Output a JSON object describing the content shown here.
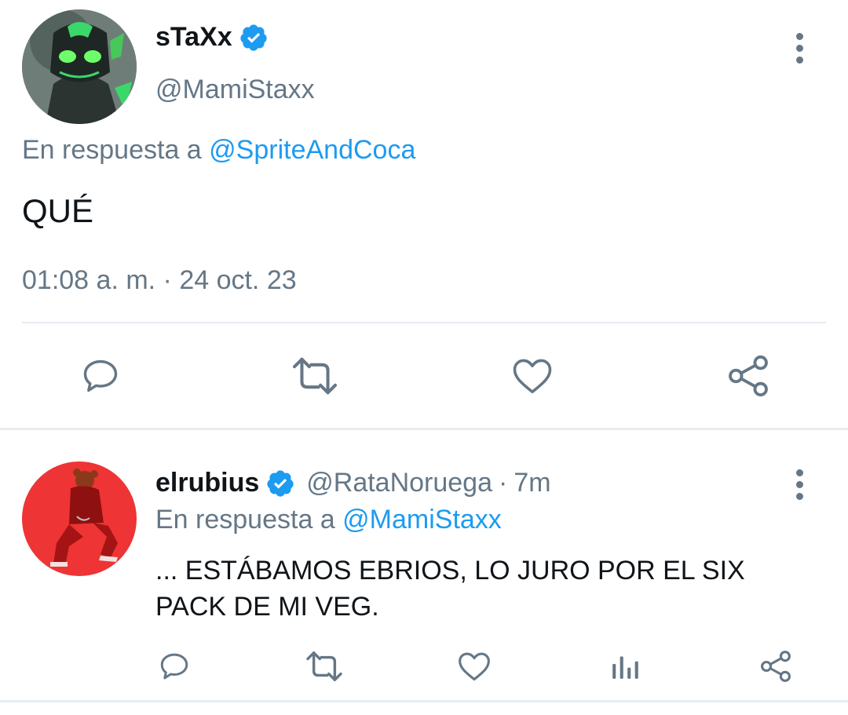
{
  "main_tweet": {
    "display_name": "sTaXx",
    "handle": "@MamiStaxx",
    "reply_prefix": "En respuesta a",
    "reply_to": "@SpriteAndCoca",
    "text": "QUÉ",
    "timestamp": "01:08 a. m. · 24 oct. 23",
    "actions": [
      "reply-icon",
      "retweet-icon",
      "like-icon",
      "share-icon"
    ]
  },
  "reply_tweet": {
    "display_name": "elrubius",
    "handle": "@RataNoruega",
    "separator": "·",
    "age": "7m",
    "reply_prefix": "En respuesta a",
    "reply_to": "@MamiStaxx",
    "text": "... ESTÁBAMOS EBRIOS, LO JURO POR EL SIX PACK DE MI VEG.",
    "actions": [
      "reply-icon",
      "retweet-icon",
      "like-icon",
      "analytics-icon",
      "share-icon"
    ]
  },
  "colors": {
    "accent": "#1d9bf0",
    "muted": "#657786",
    "divider": "#e6ecf0"
  }
}
